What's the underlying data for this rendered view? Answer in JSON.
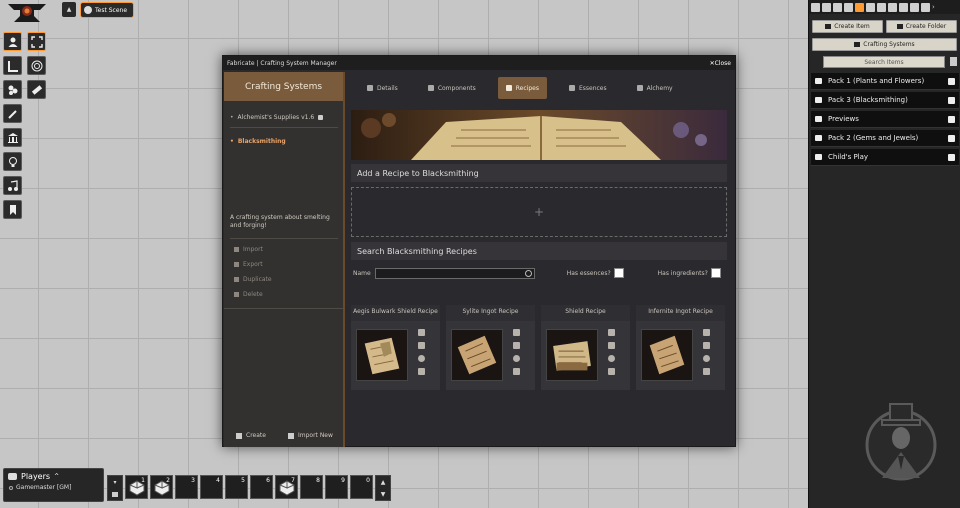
{
  "scene": {
    "tab_label": "Test Scene"
  },
  "window": {
    "title": "Fabricate | Crafting System Manager",
    "close_label": "Close",
    "sidebar": {
      "heading": "Crafting Systems",
      "systems": [
        "Alchemist's Supplies v1.6",
        "Blacksmithing"
      ],
      "description": "A crafting system about smelting and forging!",
      "actions": [
        "Import",
        "Export",
        "Duplicate",
        "Delete"
      ],
      "create_label": "Create",
      "import_new_label": "Import New"
    },
    "tabs": [
      "Details",
      "Components",
      "Recipes",
      "Essences",
      "Alchemy"
    ],
    "active_tab": "Recipes",
    "add_recipe_heading": "Add a Recipe to Blacksmithing",
    "dropzone_icon": "+",
    "search_heading": "Search Blacksmithing Recipes",
    "filters": {
      "name_label": "Name",
      "name_value": "",
      "has_essences_label": "Has essences?",
      "has_ingredients_label": "Has ingredients?"
    },
    "recipes": [
      {
        "title": "Aegis Bulwark Shield Recipe"
      },
      {
        "title": "Sylite Ingot Recipe"
      },
      {
        "title": "Shield Recipe"
      },
      {
        "title": "Infernite Ingot Recipe"
      }
    ]
  },
  "right_panel": {
    "create_item_label": "Create Item",
    "create_folder_label": "Create Folder",
    "crafting_systems_label": "Crafting Systems",
    "search_placeholder": "Search Items",
    "folders": [
      "Pack 1 (Plants and Flowers)",
      "Pack 3 (Blacksmithing)",
      "Previews",
      "Pack 2 (Gems and Jewels)",
      "Child's Play"
    ]
  },
  "players": {
    "title": "Players",
    "list": [
      "Gamemaster [GM]"
    ]
  },
  "hotbar": {
    "slots": [
      "1",
      "2",
      "3",
      "4",
      "5",
      "6",
      "7",
      "8",
      "9",
      "0"
    ]
  },
  "colors": {
    "accent": "#ff9a33",
    "brown": "#7a5c3d",
    "panel": "#2a2a2e"
  }
}
